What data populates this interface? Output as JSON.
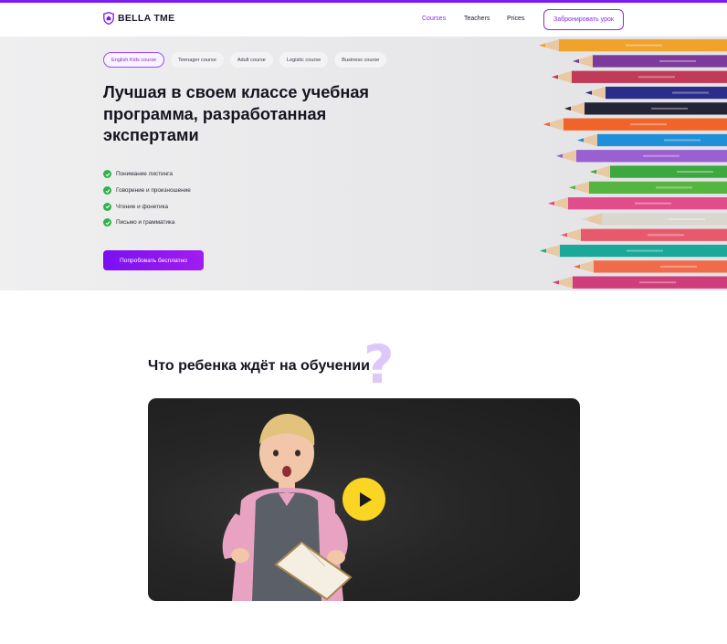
{
  "brand": {
    "name": "BELLA TME",
    "accent": "#8a2be2",
    "logo_icon": "shield-logo-icon"
  },
  "nav": {
    "items": [
      {
        "label": "Courses",
        "active": true
      },
      {
        "label": "Teachers",
        "active": false
      },
      {
        "label": "Prices",
        "active": false
      }
    ],
    "cta_label": "Забронировать урок"
  },
  "hero": {
    "chips": [
      {
        "label": "English Kids course",
        "active": true
      },
      {
        "label": "Teenager course",
        "active": false
      },
      {
        "label": "Adult course",
        "active": false
      },
      {
        "label": "Logistic course",
        "active": false
      },
      {
        "label": "Business course",
        "active": false
      }
    ],
    "title": "Лучшая в своем классе учебная программа, разработанная экспертами",
    "features": [
      "Понимание листинга",
      "Говорение и произношение",
      "Чтение и фонетика",
      "Письмо и грамматика"
    ],
    "feature_icon": "check-circle-icon",
    "feature_icon_color": "#2bb44a",
    "cta_label": "Попробовать бесплатно"
  },
  "section": {
    "title": "Что ребенка ждёт на обучении",
    "decor_glyph": "?",
    "video": {
      "play_icon": "play-icon",
      "play_color": "#fbd523"
    }
  }
}
